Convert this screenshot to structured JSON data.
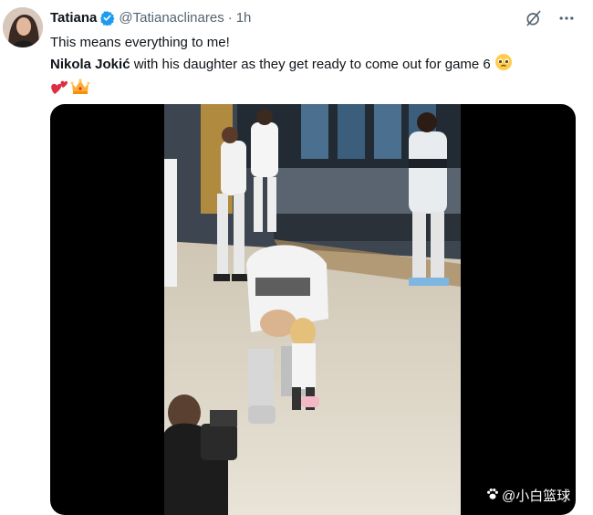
{
  "tweet": {
    "author_name": "Tatiana",
    "handle": "@Tatianaclinares",
    "separator": "·",
    "time": "1h",
    "line1": "This means everything to me!",
    "line2_bold": "Nikola Jokić",
    "line2_rest": " with his daughter as they get ready to come out for game 6 ",
    "emojis": [
      "pleading-face",
      "two-hearts",
      "crown"
    ]
  },
  "media": {
    "watermark": "@小白篮球"
  },
  "colors": {
    "verified": "#1d9bf0",
    "muted": "#536471",
    "text": "#0f1419"
  },
  "icons": [
    "grok-icon",
    "more-icon",
    "verified-badge-icon",
    "paw-icon"
  ]
}
